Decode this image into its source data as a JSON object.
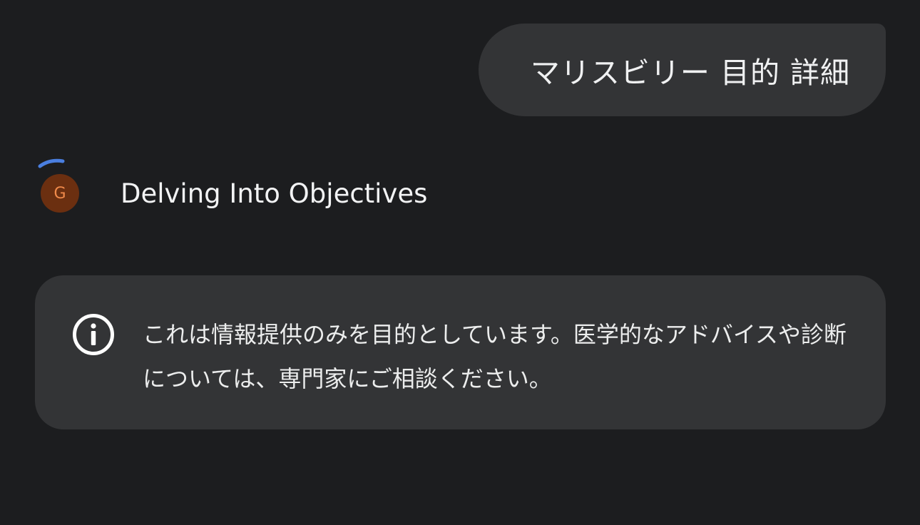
{
  "user_message": {
    "text": "マリスビリー 目的 詳細"
  },
  "assistant": {
    "avatar_letter": "G",
    "status": "Delving Into Objectives",
    "spinner_color": "#4a7fe0"
  },
  "disclaimer": {
    "icon": "info-icon",
    "text": "これは情報提供のみを目的としています。医学的なアドバイスや診断については、専門家にご相談ください。"
  }
}
